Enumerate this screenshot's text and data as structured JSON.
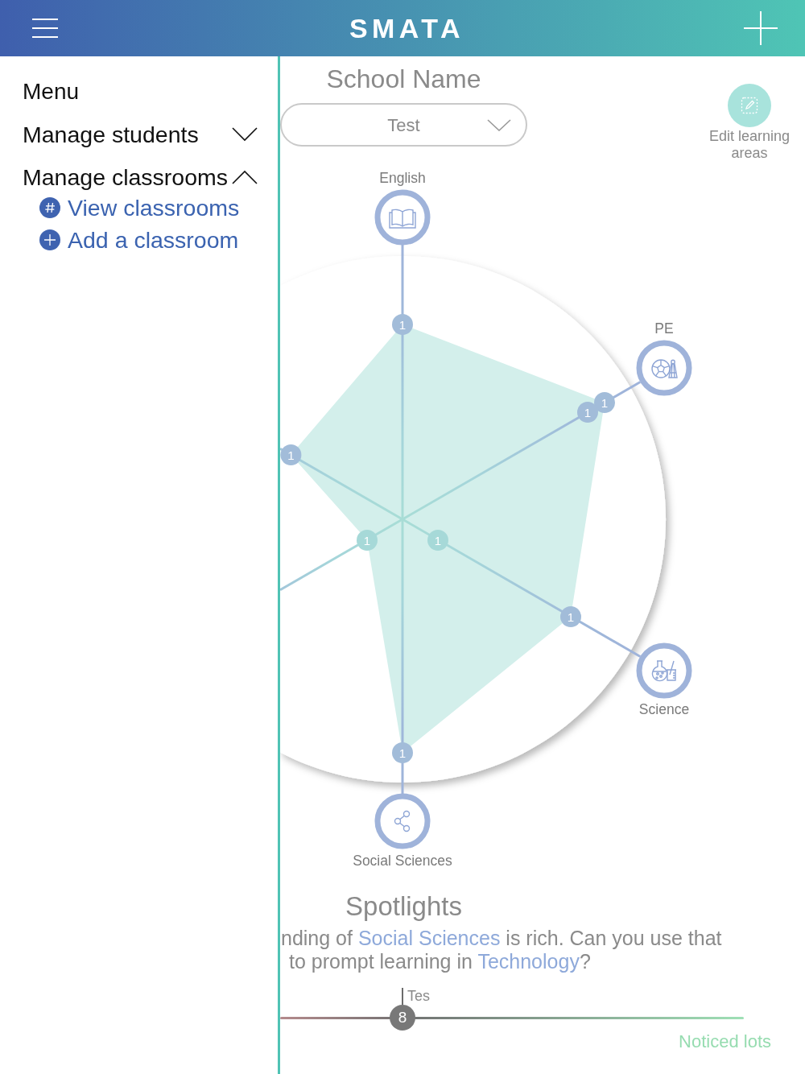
{
  "header": {
    "title": "SMATA"
  },
  "sidebar": {
    "title": "Menu",
    "sections": [
      {
        "label": "Manage students",
        "expanded": false
      },
      {
        "label": "Manage classrooms",
        "expanded": true,
        "children": [
          {
            "label": "View classrooms",
            "kind": "view"
          },
          {
            "label": "Add a classroom",
            "kind": "add"
          }
        ]
      }
    ]
  },
  "school": {
    "title": "School Name",
    "classroom_select": {
      "value": "Test"
    }
  },
  "edit_button": {
    "label": "Edit learning areas"
  },
  "chart": {
    "areas": [
      {
        "label": "English"
      },
      {
        "label": "PE"
      },
      {
        "label": "Science"
      },
      {
        "label": "Social Sciences"
      }
    ],
    "point_values": [
      "1",
      "1",
      "1",
      "1",
      "1",
      "1",
      "1",
      "1"
    ]
  },
  "spotlights": {
    "title": "Spotlights",
    "lines": [
      [
        {
          "text": "nding of ",
          "kind": "plain"
        },
        {
          "text": "Social Sciences",
          "kind": "link"
        },
        {
          "text": " is rich. Can you use that",
          "kind": "plain"
        }
      ],
      [
        {
          "text": "to prompt learning in ",
          "kind": "plain"
        },
        {
          "text": "Technology",
          "kind": "link"
        },
        {
          "text": "?",
          "kind": "plain"
        }
      ]
    ]
  },
  "slider": {
    "level": 0.264,
    "value": "8",
    "marker_label": "Tes",
    "end_label": "Noticed lots"
  }
}
